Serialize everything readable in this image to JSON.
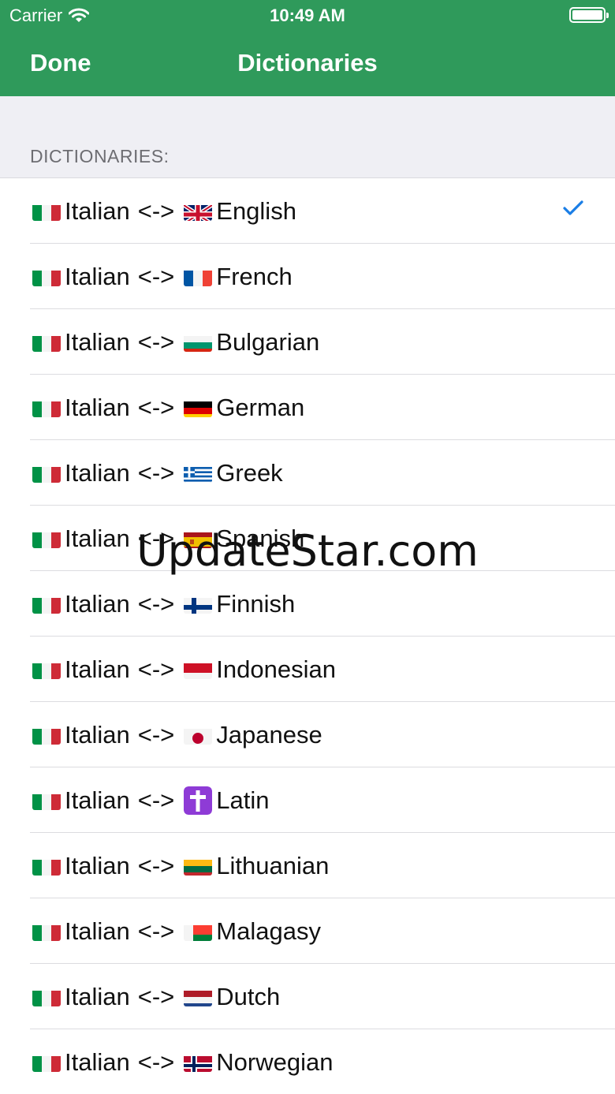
{
  "status_bar": {
    "carrier": "Carrier",
    "time": "10:49 AM"
  },
  "nav": {
    "done_label": "Done",
    "title": "Dictionaries"
  },
  "section": {
    "header": "DICTIONARIES:"
  },
  "source_flag": "italy-flag-icon",
  "rows": [
    {
      "from": "Italian",
      "arrow": "<->",
      "to": "English",
      "to_flag": "uk-flag-icon",
      "checked": true
    },
    {
      "from": "Italian",
      "arrow": "<->",
      "to": "French",
      "to_flag": "france-flag-icon",
      "checked": false
    },
    {
      "from": "Italian",
      "arrow": "<->",
      "to": "Bulgarian",
      "to_flag": "bulgaria-flag-icon",
      "checked": false
    },
    {
      "from": "Italian",
      "arrow": "<->",
      "to": "German",
      "to_flag": "germany-flag-icon",
      "checked": false
    },
    {
      "from": "Italian",
      "arrow": "<->",
      "to": "Greek",
      "to_flag": "greece-flag-icon",
      "checked": false
    },
    {
      "from": "Italian",
      "arrow": "<->",
      "to": "Spanish",
      "to_flag": "spain-flag-icon",
      "checked": false
    },
    {
      "from": "Italian",
      "arrow": "<->",
      "to": "Finnish",
      "to_flag": "finland-flag-icon",
      "checked": false
    },
    {
      "from": "Italian",
      "arrow": "<->",
      "to": "Indonesian",
      "to_flag": "indonesia-flag-icon",
      "checked": false
    },
    {
      "from": "Italian",
      "arrow": "<->",
      "to": "Japanese",
      "to_flag": "japan-flag-icon",
      "checked": false
    },
    {
      "from": "Italian",
      "arrow": "<->",
      "to": "Latin",
      "to_flag": "latin-cross-icon",
      "checked": false
    },
    {
      "from": "Italian",
      "arrow": "<->",
      "to": "Lithuanian",
      "to_flag": "lithuania-flag-icon",
      "checked": false
    },
    {
      "from": "Italian",
      "arrow": "<->",
      "to": "Malagasy",
      "to_flag": "madagascar-flag-icon",
      "checked": false
    },
    {
      "from": "Italian",
      "arrow": "<->",
      "to": "Dutch",
      "to_flag": "netherlands-flag-icon",
      "checked": false
    },
    {
      "from": "Italian",
      "arrow": "<->",
      "to": "Norwegian",
      "to_flag": "norway-flag-icon",
      "checked": false
    }
  ],
  "watermark": "UpdateStar.com",
  "colors": {
    "brand": "#2f9a5b",
    "check": "#1a7ee6",
    "section_bg": "#efeff4"
  }
}
